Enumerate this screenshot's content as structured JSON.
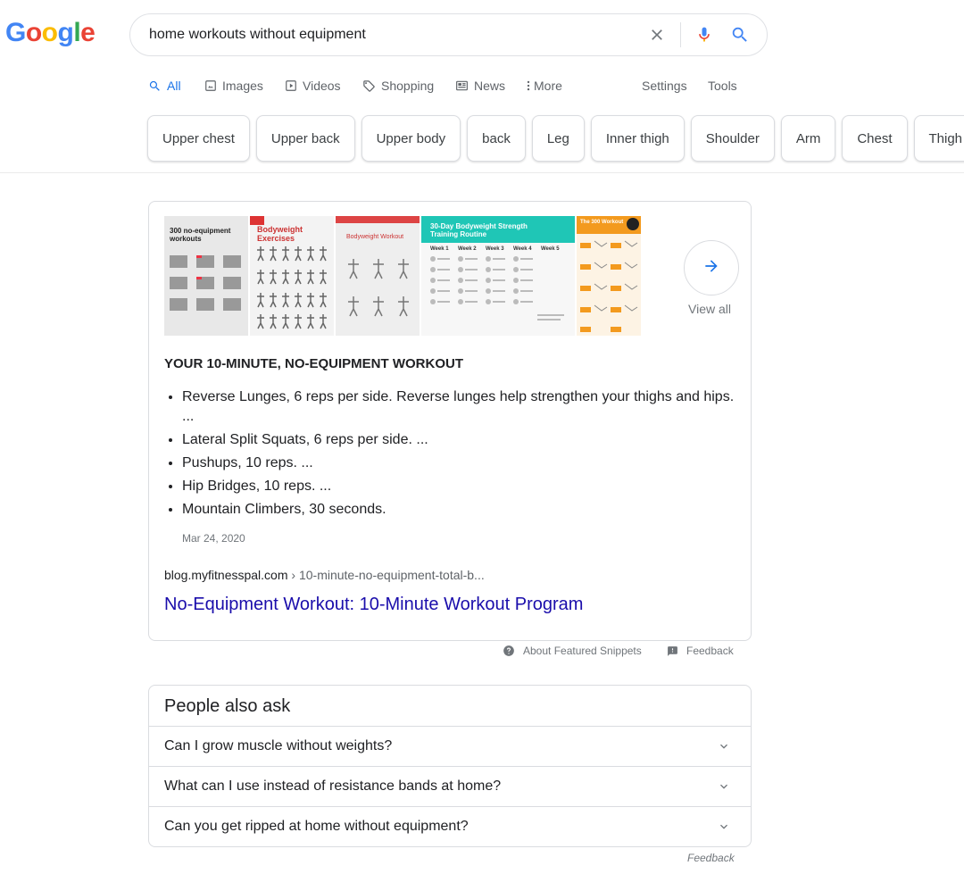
{
  "logo": {
    "letters": [
      "G",
      "o",
      "o",
      "g",
      "l",
      "e"
    ],
    "colors": [
      "#4285f4",
      "#ea4335",
      "#fbbc05",
      "#4285f4",
      "#34a853",
      "#ea4335"
    ]
  },
  "search": {
    "query": "home workouts without equipment"
  },
  "tabs": [
    {
      "label": "All",
      "icon": "search-icon"
    },
    {
      "label": "Images",
      "icon": "image-icon"
    },
    {
      "label": "Videos",
      "icon": "video-icon"
    },
    {
      "label": "Shopping",
      "icon": "tag-icon"
    },
    {
      "label": "News",
      "icon": "newspaper-icon"
    },
    {
      "label": "More",
      "icon": "more-vertical-icon"
    },
    {
      "label": "Settings"
    },
    {
      "label": "Tools"
    }
  ],
  "chips": [
    "Upper chest",
    "Upper back",
    "Upper body",
    "back",
    "Leg",
    "Inner thigh",
    "Shoulder",
    "Arm",
    "Chest",
    "Thigh"
  ],
  "snippet": {
    "images": [
      {
        "text": "300 no-equipment workouts"
      },
      {
        "text": "Bodyweight Exercises"
      },
      {
        "text": "Bodyweight Workout"
      },
      {
        "text": "30-Day Bodyweight Strength Training Routine",
        "cols": [
          "Week 1",
          "Week 2",
          "Week 3",
          "Week 4",
          "Week 5"
        ]
      },
      {
        "text": "The 300 Workout"
      }
    ],
    "view_all": "View all",
    "title": "YOUR 10-MINUTE, NO-EQUIPMENT WORKOUT",
    "items": [
      "Reverse Lunges, 6 reps per side. Reverse lunges help strengthen your thighs and hips. ...",
      "Lateral Split Squats, 6 reps per side. ...",
      "Pushups, 10 reps. ...",
      "Hip Bridges, 10 reps. ...",
      "Mountain Climbers, 30 seconds."
    ],
    "date": "Mar 24, 2020",
    "cite_domain": "blog.myfitnesspal.com",
    "cite_path": " › 10-minute-no-equipment-total-b...",
    "link_title": "No-Equipment Workout: 10-Minute Workout Program"
  },
  "snippet_footer": {
    "about": "About Featured Snippets",
    "feedback": "Feedback"
  },
  "paa": {
    "title": "People also ask",
    "questions": [
      "Can I grow muscle without weights?",
      "What can I use instead of resistance bands at home?",
      "Can you get ripped at home without equipment?"
    ],
    "feedback": "Feedback"
  }
}
